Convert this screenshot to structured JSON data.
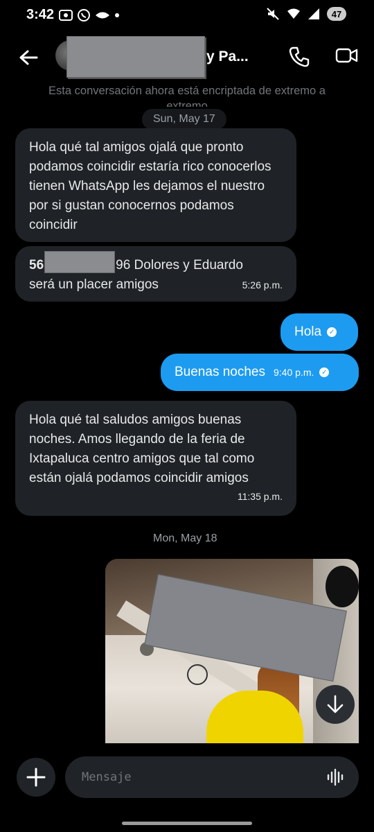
{
  "status_bar": {
    "time": "3:42",
    "battery": "47"
  },
  "header": {
    "contact_name_visible": "y Pa...",
    "back_icon": "arrow-left-icon",
    "call_icon": "phone-icon",
    "video_icon": "video-camera-icon"
  },
  "encryption_notice": "Esta conversación ahora está encriptada de extremo a extremo",
  "dates": {
    "first": "Sun, May 17",
    "second": "Mon, May 18"
  },
  "messages": [
    {
      "direction": "in",
      "text": "Hola qué tal amigos ojalá que pronto podamos coincidir estaría rico conocerlos tienen WhatsApp les dejamos el nuestro por si gustan conocernos podamos coincidir",
      "time": ""
    },
    {
      "direction": "in",
      "text_prefix": "56",
      "text_suffix": "96 Dolores y Eduardo",
      "text_line2": "será un placer amigos",
      "time": "5:26 p.m."
    },
    {
      "direction": "out",
      "text": "Hola",
      "time": ""
    },
    {
      "direction": "out",
      "text": "Buenas noches",
      "time": "9:40 p.m."
    },
    {
      "direction": "in",
      "text": "Hola qué tal saludos amigos buenas noches. Amos llegando de la feria de Ixtapaluca centro amigos que tal como están ojalá podamos coincidir amigos",
      "time": "11:35 p.m."
    }
  ],
  "composer": {
    "placeholder": "Mensaje"
  },
  "colors": {
    "accent": "#1d9bf0",
    "bubble_in": "#1f2226",
    "background": "#000000"
  }
}
